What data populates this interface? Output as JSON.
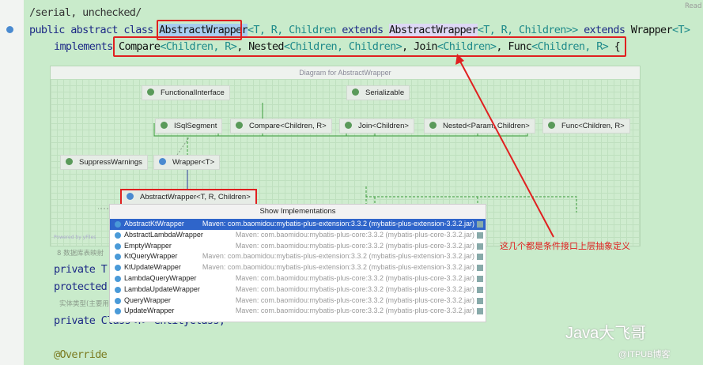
{
  "editor": {
    "comment": "/serial, unchecked/",
    "reader_mode": "Read",
    "line2": {
      "kw": "public abstract class ",
      "name": "AbstractWrapper",
      "generic1": "<T, R, Children ",
      "ext": "extends ",
      "sup": "AbstractWrapper",
      "generic2": "<T, R, Children>> ",
      "ext2": "extends ",
      "wrapper": "Wrapper",
      "generic3": "<T>"
    },
    "line3": {
      "impl": "implements ",
      "compare": "Compare",
      "g1": "<Children, R>",
      "sep1": ", ",
      "nested": "Nested",
      "g2": "<Children, Children>",
      "sep2": ", ",
      "join": "Join",
      "g3": "<Children>",
      "sep3": ", ",
      "func": "Func",
      "g4": "<Children, R>",
      "brace": " {"
    },
    "lines": [
      "private T",
      "protected",
      "private Class<T> entityClass;",
      "@Override"
    ],
    "hints": [
      "8 数据库表映射",
      "实体类型(主要用"
    ]
  },
  "diagram": {
    "title": "Diagram for AbstractWrapper",
    "nodes": [
      "FunctionalInterface",
      "Serializable",
      "ISqlSegment",
      "Compare<Children, R>",
      "Join<Children>",
      "Nested<Param, Children>",
      "Func<Children, R>",
      "SuppressWarnings",
      "Wrapper<T>",
      "AbstractWrapper<T, R, Children>"
    ],
    "powered": "Powered by yFiles"
  },
  "popup": {
    "title": "Show Implementations",
    "items": [
      {
        "name": "AbstractKtWrapper",
        "module": "Maven: com.baomidou:mybatis-plus-extension:3.3.2 (mybatis-plus-extension-3.3.2.jar)"
      },
      {
        "name": "AbstractLambdaWrapper",
        "module": "Maven: com.baomidou:mybatis-plus-core:3.3.2 (mybatis-plus-core-3.3.2.jar)"
      },
      {
        "name": "EmptyWrapper",
        "module": "Maven: com.baomidou:mybatis-plus-core:3.3.2 (mybatis-plus-core-3.3.2.jar)"
      },
      {
        "name": "KtQueryWrapper",
        "module": "Maven: com.baomidou:mybatis-plus-extension:3.3.2 (mybatis-plus-extension-3.3.2.jar)"
      },
      {
        "name": "KtUpdateWrapper",
        "module": "Maven: com.baomidou:mybatis-plus-extension:3.3.2 (mybatis-plus-extension-3.3.2.jar)"
      },
      {
        "name": "LambdaQueryWrapper",
        "module": "Maven: com.baomidou:mybatis-plus-core:3.3.2 (mybatis-plus-core-3.3.2.jar)"
      },
      {
        "name": "LambdaUpdateWrapper",
        "module": "Maven: com.baomidou:mybatis-plus-core:3.3.2 (mybatis-plus-core-3.3.2.jar)"
      },
      {
        "name": "QueryWrapper",
        "module": "Maven: com.baomidou:mybatis-plus-core:3.3.2 (mybatis-plus-core-3.3.2.jar)"
      },
      {
        "name": "UpdateWrapper",
        "module": "Maven: com.baomidou:mybatis-plus-core:3.3.2 (mybatis-plus-core-3.3.2.jar)"
      }
    ]
  },
  "annotation": "这几个都是条件接口上层抽象定义",
  "watermark": {
    "main": "Java大飞哥",
    "sub": "@ITPUB博客"
  }
}
